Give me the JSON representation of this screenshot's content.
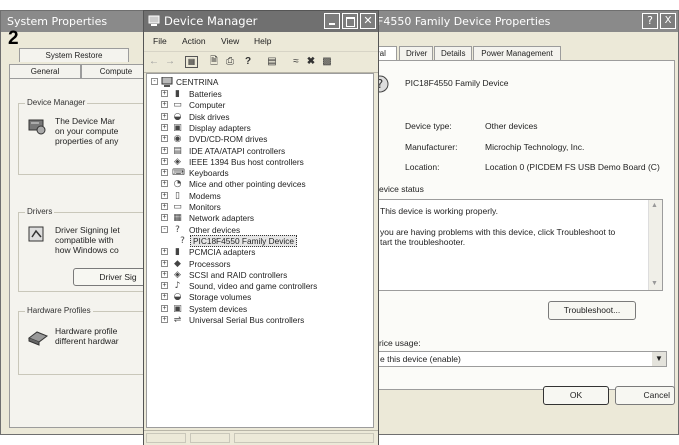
{
  "step_number": "2",
  "system_properties": {
    "title": "System Properties",
    "tabs_row1": [
      "System Restore"
    ],
    "tabs_row2": [
      "General",
      "Compute"
    ],
    "device_manager_group": {
      "label": "Device Manager",
      "text_lines": [
        "The Device Mar",
        "on your compute",
        "properties of any"
      ]
    },
    "drivers_group": {
      "label": "Drivers",
      "text_lines": [
        "Driver Signing let",
        "compatible with",
        "how Windows co"
      ],
      "button": "Driver Sig"
    },
    "hardware_profiles_group": {
      "label": "Hardware Profiles",
      "text_lines": [
        "Hardware profile",
        "different hardwar"
      ]
    }
  },
  "device_manager": {
    "title": "Device Manager",
    "menu": [
      "File",
      "Action",
      "View",
      "Help"
    ],
    "root": "CENTRINA",
    "tree": [
      {
        "label": "Batteries",
        "icon": "battery-icon",
        "expander": "+"
      },
      {
        "label": "Computer",
        "icon": "computer-icon",
        "expander": "+"
      },
      {
        "label": "Disk drives",
        "icon": "disk-drive-icon",
        "expander": "+"
      },
      {
        "label": "Display adapters",
        "icon": "display-adapter-icon",
        "expander": "+"
      },
      {
        "label": "DVD/CD-ROM drives",
        "icon": "cdrom-icon",
        "expander": "+"
      },
      {
        "label": "IDE ATA/ATAPI controllers",
        "icon": "ide-controller-icon",
        "expander": "+"
      },
      {
        "label": "IEEE 1394 Bus host controllers",
        "icon": "ieee1394-icon",
        "expander": "+"
      },
      {
        "label": "Keyboards",
        "icon": "keyboard-icon",
        "expander": "+"
      },
      {
        "label": "Mice and other pointing devices",
        "icon": "mouse-icon",
        "expander": "+"
      },
      {
        "label": "Modems",
        "icon": "modem-icon",
        "expander": "+"
      },
      {
        "label": "Monitors",
        "icon": "monitor-icon",
        "expander": "+"
      },
      {
        "label": "Network adapters",
        "icon": "network-adapter-icon",
        "expander": "+"
      },
      {
        "label": "Other devices",
        "icon": "unknown-device-icon",
        "expander": "-"
      },
      {
        "label": "PIC18F4550 Family Device",
        "icon": "unknown-device-icon",
        "expander": "",
        "child": true,
        "selected": true
      },
      {
        "label": "PCMCIA adapters",
        "icon": "pcmcia-icon",
        "expander": "+"
      },
      {
        "label": "Processors",
        "icon": "processor-icon",
        "expander": "+"
      },
      {
        "label": "SCSI and RAID controllers",
        "icon": "scsi-icon",
        "expander": "+"
      },
      {
        "label": "Sound, video and game controllers",
        "icon": "sound-icon",
        "expander": "+"
      },
      {
        "label": "Storage volumes",
        "icon": "storage-icon",
        "expander": "+"
      },
      {
        "label": "System devices",
        "icon": "system-device-icon",
        "expander": "+"
      },
      {
        "label": "Universal Serial Bus controllers",
        "icon": "usb-icon",
        "expander": "+"
      }
    ]
  },
  "device_properties": {
    "title": "F4550 Family Device Properties",
    "help_button": "?",
    "close_button": "X",
    "tabs": [
      "ral",
      "Driver",
      "Details",
      "Power Management"
    ],
    "device_name": "PIC18F4550 Family Device",
    "fields": [
      {
        "label": "Device type:",
        "value": "Other devices"
      },
      {
        "label": "Manufacturer:",
        "value": "Microchip Technology, Inc."
      },
      {
        "label": "Location:",
        "value": "Location 0 (PICDEM FS USB Demo Board (C)"
      }
    ],
    "status_label": "evice status",
    "status_text": [
      "This device is working properly.",
      "",
      "you are having problems with this device, click Troubleshoot to",
      "tart the troubleshooter."
    ],
    "troubleshoot_button": "Troubleshoot...",
    "usage_label": "rice usage:",
    "usage_value": "e this device (enable)",
    "ok_button": "OK",
    "cancel_button": "Cancel"
  }
}
